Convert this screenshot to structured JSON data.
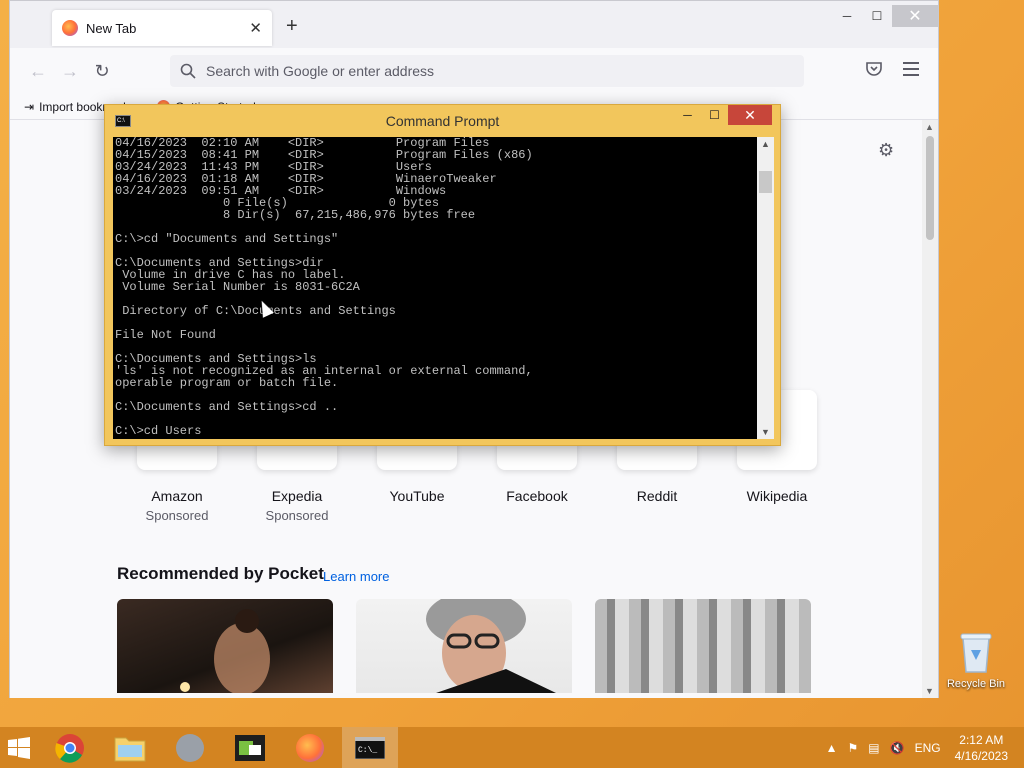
{
  "browser": {
    "tab_title": "New Tab",
    "new_tab": "+",
    "search_placeholder": "Search with Google or enter address",
    "bookmarks": [
      "Import bookmarks",
      "Getting Started"
    ]
  },
  "shortcuts": [
    {
      "name": "Amazon",
      "sponsored": "Sponsored"
    },
    {
      "name": "Expedia",
      "sponsored": "Sponsored"
    },
    {
      "name": "YouTube",
      "sponsored": ""
    },
    {
      "name": "Facebook",
      "sponsored": ""
    },
    {
      "name": "Reddit",
      "sponsored": ""
    },
    {
      "name": "Wikipedia",
      "sponsored": ""
    }
  ],
  "pocket": {
    "title": "Recommended by Pocket",
    "link": "Learn more"
  },
  "cmd": {
    "title": "Command Prompt",
    "icon_text": "C:\\",
    "lines": [
      "04/16/2023  02:10 AM    <DIR>          Program Files",
      "04/15/2023  08:41 PM    <DIR>          Program Files (x86)",
      "03/24/2023  11:43 PM    <DIR>          Users",
      "04/16/2023  01:18 AM    <DIR>          WinaeroTweaker",
      "03/24/2023  09:51 AM    <DIR>          Windows",
      "               0 File(s)              0 bytes",
      "               8 Dir(s)  67,215,486,976 bytes free",
      "",
      "C:\\>cd \"Documents and Settings\"",
      "",
      "C:\\Documents and Settings>dir",
      " Volume in drive C has no label.",
      " Volume Serial Number is 8031-6C2A",
      "",
      " Directory of C:\\Documents and Settings",
      "",
      "File Not Found",
      "",
      "C:\\Documents and Settings>ls",
      "'ls' is not recognized as an internal or external command,",
      "operable program or batch file.",
      "",
      "C:\\Documents and Settings>cd ..",
      "",
      "C:\\>cd Users"
    ]
  },
  "desktop": {
    "recycle_bin": "Recycle Bin"
  },
  "taskbar": {
    "lang": "ENG",
    "time": "2:12 AM",
    "date": "4/16/2023"
  },
  "colors": {
    "desktop": "#f0a23a",
    "cmd_frame": "#f2c65c",
    "cmd_close": "#c7463a",
    "link": "#0061e0"
  }
}
